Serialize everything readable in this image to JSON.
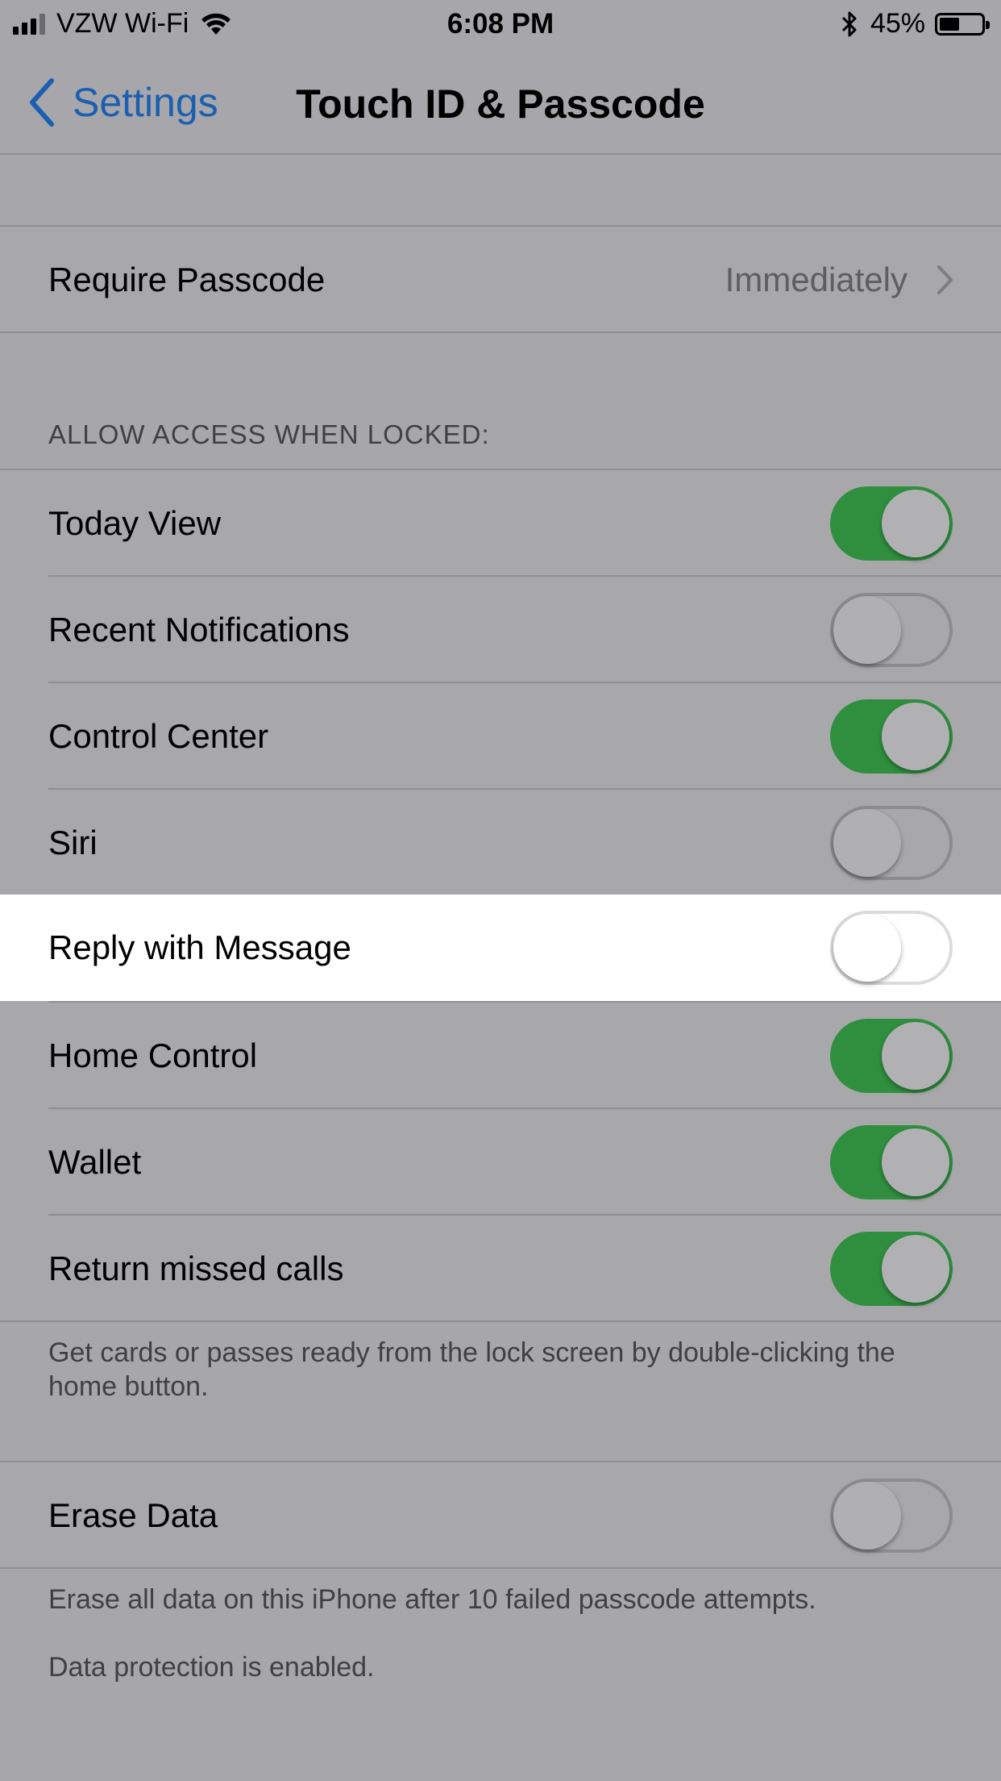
{
  "status_bar": {
    "carrier": "VZW Wi-Fi",
    "time": "6:08 PM",
    "battery": "45%"
  },
  "nav": {
    "back_label": "Settings",
    "title": "Touch ID & Passcode"
  },
  "require_passcode": {
    "label": "Require Passcode",
    "value": "Immediately"
  },
  "section_header": "ALLOW ACCESS WHEN LOCKED:",
  "access_items": [
    {
      "label": "Today View",
      "on": true
    },
    {
      "label": "Recent Notifications",
      "on": false
    },
    {
      "label": "Control Center",
      "on": true
    },
    {
      "label": "Siri",
      "on": false
    },
    {
      "label": "Reply with Message",
      "on": false
    },
    {
      "label": "Home Control",
      "on": true
    },
    {
      "label": "Wallet",
      "on": true
    },
    {
      "label": "Return missed calls",
      "on": true
    }
  ],
  "access_footer": "Get cards or passes ready from the lock screen by double-clicking the home button.",
  "erase_data": {
    "label": "Erase Data",
    "on": false
  },
  "erase_footer": "Erase all data on this iPhone after 10 failed passcode attempts.",
  "protection_note": "Data protection is enabled.",
  "colors": {
    "toggle_on": "#2f8f3f",
    "link_blue": "#1a5fb0",
    "dimmed_background": "#a6a6ab"
  }
}
